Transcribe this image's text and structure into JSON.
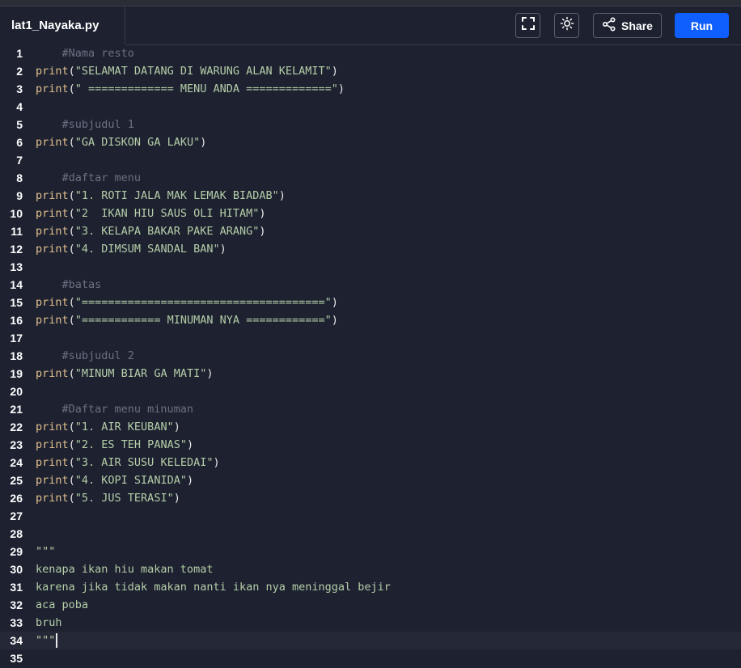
{
  "tab": {
    "filename": "lat1_Nayaka.py"
  },
  "toolbar": {
    "fullscreen_icon": "fullscreen-icon",
    "theme_icon": "sun-icon",
    "share_icon": "share-icon",
    "share_label": "Share",
    "run_label": "Run",
    "run_color": "#0f5fff"
  },
  "editor": {
    "active_line": 34,
    "lines": [
      {
        "n": "1",
        "t": [
          {
            "k": "cmt",
            "s": "    #Nama resto"
          }
        ]
      },
      {
        "n": "2",
        "t": [
          {
            "k": "fn",
            "s": "print"
          },
          {
            "k": "punc",
            "s": "("
          },
          {
            "k": "str",
            "s": "\"SELAMAT DATANG DI WARUNG ALAN KELAMIT\""
          },
          {
            "k": "punc",
            "s": ")"
          }
        ]
      },
      {
        "n": "3",
        "t": [
          {
            "k": "fn",
            "s": "print"
          },
          {
            "k": "punc",
            "s": "("
          },
          {
            "k": "str",
            "s": "\" ============= MENU ANDA =============\""
          },
          {
            "k": "punc",
            "s": ")"
          }
        ]
      },
      {
        "n": "4",
        "t": []
      },
      {
        "n": "5",
        "t": [
          {
            "k": "cmt",
            "s": "    #subjudul 1"
          }
        ]
      },
      {
        "n": "6",
        "t": [
          {
            "k": "fn",
            "s": "print"
          },
          {
            "k": "punc",
            "s": "("
          },
          {
            "k": "str",
            "s": "\"GA DISKON GA LAKU\""
          },
          {
            "k": "punc",
            "s": ")"
          }
        ]
      },
      {
        "n": "7",
        "t": []
      },
      {
        "n": "8",
        "t": [
          {
            "k": "cmt",
            "s": "    #daftar menu"
          }
        ]
      },
      {
        "n": "9",
        "t": [
          {
            "k": "fn",
            "s": "print"
          },
          {
            "k": "punc",
            "s": "("
          },
          {
            "k": "str",
            "s": "\"1. ROTI JALA MAK LEMAK BIADAB\""
          },
          {
            "k": "punc",
            "s": ")"
          }
        ]
      },
      {
        "n": "10",
        "t": [
          {
            "k": "fn",
            "s": "print"
          },
          {
            "k": "punc",
            "s": "("
          },
          {
            "k": "str",
            "s": "\"2  IKAN HIU SAUS OLI HITAM\""
          },
          {
            "k": "punc",
            "s": ")"
          }
        ]
      },
      {
        "n": "11",
        "t": [
          {
            "k": "fn",
            "s": "print"
          },
          {
            "k": "punc",
            "s": "("
          },
          {
            "k": "str",
            "s": "\"3. KELAPA BAKAR PAKE ARANG\""
          },
          {
            "k": "punc",
            "s": ")"
          }
        ]
      },
      {
        "n": "12",
        "t": [
          {
            "k": "fn",
            "s": "print"
          },
          {
            "k": "punc",
            "s": "("
          },
          {
            "k": "str",
            "s": "\"4. DIMSUM SANDAL BAN\""
          },
          {
            "k": "punc",
            "s": ")"
          }
        ]
      },
      {
        "n": "13",
        "t": []
      },
      {
        "n": "14",
        "t": [
          {
            "k": "cmt",
            "s": "    #batas"
          }
        ]
      },
      {
        "n": "15",
        "t": [
          {
            "k": "fn",
            "s": "print"
          },
          {
            "k": "punc",
            "s": "("
          },
          {
            "k": "str",
            "s": "\"=====================================\""
          },
          {
            "k": "punc",
            "s": ")"
          }
        ]
      },
      {
        "n": "16",
        "t": [
          {
            "k": "fn",
            "s": "print"
          },
          {
            "k": "punc",
            "s": "("
          },
          {
            "k": "str",
            "s": "\"============ MINUMAN NYA ============\""
          },
          {
            "k": "punc",
            "s": ")"
          }
        ]
      },
      {
        "n": "17",
        "t": []
      },
      {
        "n": "18",
        "t": [
          {
            "k": "cmt",
            "s": "    #subjudul 2"
          }
        ]
      },
      {
        "n": "19",
        "t": [
          {
            "k": "fn",
            "s": "print"
          },
          {
            "k": "punc",
            "s": "("
          },
          {
            "k": "str",
            "s": "\"MINUM BIAR GA MATI\""
          },
          {
            "k": "punc",
            "s": ")"
          }
        ]
      },
      {
        "n": "20",
        "t": []
      },
      {
        "n": "21",
        "t": [
          {
            "k": "cmt",
            "s": "    #Daftar menu minuman"
          }
        ]
      },
      {
        "n": "22",
        "t": [
          {
            "k": "fn",
            "s": "print"
          },
          {
            "k": "punc",
            "s": "("
          },
          {
            "k": "str",
            "s": "\"1. AIR KEUBAN\""
          },
          {
            "k": "punc",
            "s": ")"
          }
        ]
      },
      {
        "n": "23",
        "t": [
          {
            "k": "fn",
            "s": "print"
          },
          {
            "k": "punc",
            "s": "("
          },
          {
            "k": "str",
            "s": "\"2. ES TEH PANAS\""
          },
          {
            "k": "punc",
            "s": ")"
          }
        ]
      },
      {
        "n": "24",
        "t": [
          {
            "k": "fn",
            "s": "print"
          },
          {
            "k": "punc",
            "s": "("
          },
          {
            "k": "str",
            "s": "\"3. AIR SUSU KELEDAI\""
          },
          {
            "k": "punc",
            "s": ")"
          }
        ]
      },
      {
        "n": "25",
        "t": [
          {
            "k": "fn",
            "s": "print"
          },
          {
            "k": "punc",
            "s": "("
          },
          {
            "k": "str",
            "s": "\"4. KOPI SIANIDA\""
          },
          {
            "k": "punc",
            "s": ")"
          }
        ]
      },
      {
        "n": "26",
        "t": [
          {
            "k": "fn",
            "s": "print"
          },
          {
            "k": "punc",
            "s": "("
          },
          {
            "k": "str",
            "s": "\"5. JUS TERASI\""
          },
          {
            "k": "punc",
            "s": ")"
          }
        ]
      },
      {
        "n": "27",
        "t": []
      },
      {
        "n": "28",
        "t": []
      },
      {
        "n": "29",
        "t": [
          {
            "k": "str",
            "s": "\"\"\""
          }
        ]
      },
      {
        "n": "30",
        "t": [
          {
            "k": "str",
            "s": "kenapa ikan hiu makan tomat"
          }
        ]
      },
      {
        "n": "31",
        "t": [
          {
            "k": "str",
            "s": "karena jika tidak makan nanti ikan nya meninggal bejir"
          }
        ]
      },
      {
        "n": "32",
        "t": [
          {
            "k": "str",
            "s": "aca poba"
          }
        ]
      },
      {
        "n": "33",
        "t": [
          {
            "k": "str",
            "s": "bruh"
          }
        ]
      },
      {
        "n": "34",
        "t": [
          {
            "k": "str",
            "s": "\"\"\""
          }
        ]
      },
      {
        "n": "35",
        "t": []
      }
    ]
  }
}
